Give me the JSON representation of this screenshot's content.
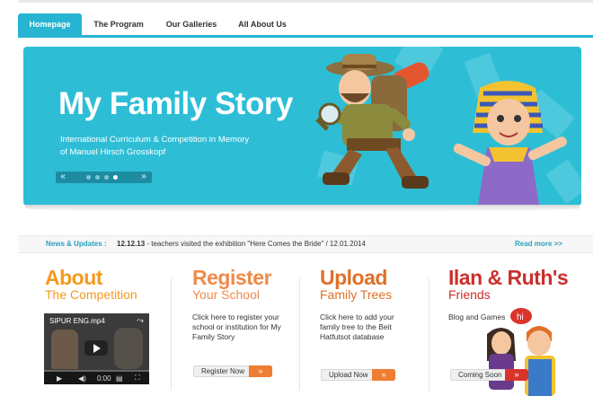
{
  "nav": {
    "tabs": [
      {
        "label": "Homepage",
        "active": true
      },
      {
        "label": "The Program",
        "active": false
      },
      {
        "label": "Our Galleries",
        "active": false
      },
      {
        "label": "All About Us",
        "active": false
      }
    ]
  },
  "banner": {
    "title": "My Family Story",
    "subtitle_line1": "International Curriculum & Competition in Memory",
    "subtitle_line2": "of Manuel Hirsch Grosskopf",
    "slider": {
      "prev": "«",
      "next": "»",
      "slides": 4,
      "current": 4
    }
  },
  "news": {
    "label": "News & Updates :",
    "date": "12.12.13",
    "text": " - teachers visited the exhibition \"Here Comes the Bride\" / 12.01.2014",
    "more": "Read more >>"
  },
  "columns": [
    {
      "title": "About",
      "subtitle": "The Competition",
      "color": "#f39a1e",
      "subcolor": "#f39a1e"
    },
    {
      "title": "Register",
      "subtitle": "Your School",
      "color": "#f08a4a",
      "subcolor": "#f08a4a",
      "body": "Click here to register your school or institution for My Family Story",
      "button": "Register Now",
      "button_arrow": "»"
    },
    {
      "title": "Upload",
      "subtitle": "Family Trees",
      "color": "#e0702a",
      "subcolor": "#e0702a",
      "body": "Click here to add your family tree to the Beit Hatfutsot database",
      "button": "Upload Now",
      "button_arrow": "»"
    },
    {
      "title": "Ilan & Ruth's",
      "subtitle": "Friends",
      "color": "#c9302c",
      "subcolor": "#c9302c",
      "body": "Blog and Games",
      "bubble": "hi",
      "button": "Coming Soon",
      "button_arrow": "»"
    }
  ],
  "video": {
    "title": "SIPUR ENG.mp4",
    "time": "0:00",
    "share_icon": "share-icon",
    "play_icon": "play-icon"
  },
  "colors": {
    "accent": "#27b4d3",
    "banner": "#2dbed6",
    "orange": "#ef7d32",
    "red": "#d9342b"
  }
}
